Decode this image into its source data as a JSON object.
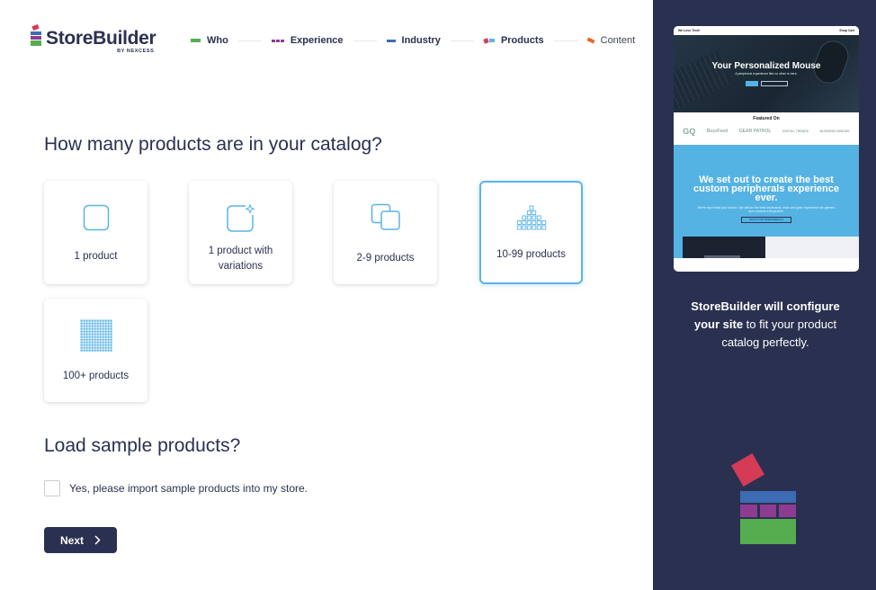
{
  "logo": {
    "title": "StoreBuilder",
    "subtitle": "BY NEXCESS"
  },
  "steps": [
    {
      "label": "Who",
      "colors": [
        "#55ad4f"
      ]
    },
    {
      "label": "Experience",
      "colors": [
        "#8e3c92",
        "#8e3c92",
        "#8e3c92"
      ]
    },
    {
      "label": "Industry",
      "colors": [
        "#3d6cb4"
      ]
    },
    {
      "label": "Products",
      "colors": [
        "#d63b56",
        "#5ab4e5"
      ]
    },
    {
      "label": "Content",
      "colors": [
        "#e8692b"
      ]
    }
  ],
  "catalog": {
    "question": "How many products are in your catalog?",
    "options": [
      {
        "label": "1 product",
        "icon": "single-square-icon",
        "selected": false
      },
      {
        "label": "1 product with variations",
        "icon": "square-with-sparkle-icon",
        "selected": false
      },
      {
        "label": "2-9 products",
        "icon": "stacked-squares-icon",
        "selected": false
      },
      {
        "label": "10-99 products",
        "icon": "pyramid-grid-icon",
        "selected": true
      },
      {
        "label": "100+ products",
        "icon": "dense-grid-icon",
        "selected": false
      }
    ]
  },
  "sample": {
    "question": "Load sample products?",
    "checkbox_label": "Yes, please import sample products into my store.",
    "checked": false
  },
  "next_button": {
    "label": "Next"
  },
  "preview": {
    "nav_brand": "We Love Tech!",
    "nav_links": "Shop  Cart",
    "hero_title": "Your Personalized Mouse",
    "hero_subtitle": "A peripheral experience like no other is here.",
    "featured_title": "Featured On",
    "featured_logos": [
      "GQ",
      "BuzzFeed",
      "GEAR PATROL",
      "DIGITAL TRENDS",
      "BUSINESS INSIDER"
    ],
    "blue_title": "We set out to create the best custom peripherals experience ever.",
    "blue_subtitle": "We're more than just a store. We deliver the best keyboards, mice and gear experience for gamers and creators everywhere.",
    "blue_button": "SHOP OUR PERIPHERALS"
  },
  "side": {
    "bold_text": "StoreBuilder will configure your site",
    "normal_text": " to fit your product catalog perfectly."
  },
  "colors": {
    "navy": "#2a3150",
    "accent_blue": "#5ab4e5",
    "green": "#55ad4f",
    "purple": "#8e3c92",
    "blue": "#3d6cb4",
    "red": "#d63b56"
  }
}
